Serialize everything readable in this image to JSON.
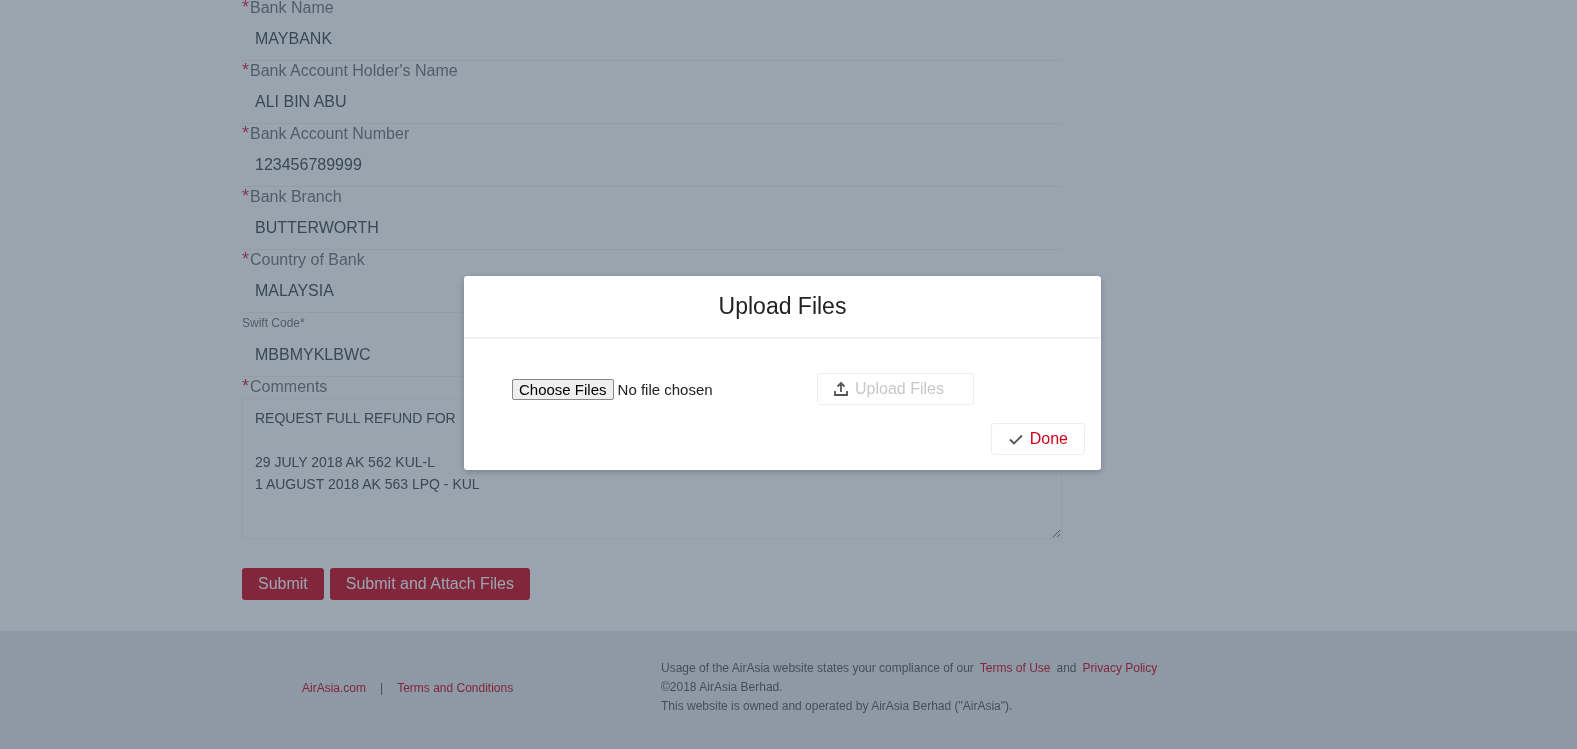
{
  "form": {
    "fields": [
      {
        "kind": "input",
        "marker": "*",
        "label": "Bank Name",
        "value": "MAYBANK"
      },
      {
        "kind": "input",
        "marker": "*",
        "label": "Bank Account Holder's Name",
        "value": "ALI BIN ABU"
      },
      {
        "kind": "input",
        "marker": "*",
        "label": "Bank Account Number",
        "value": "123456789999"
      },
      {
        "kind": "input",
        "marker": "*",
        "label": "Bank Branch",
        "value": "BUTTERWORTH"
      },
      {
        "kind": "input",
        "marker": "*",
        "label": "Country of Bank",
        "value": "MALAYSIA"
      },
      {
        "kind": "input",
        "label": "Swift Code*",
        "value": "MBBMYKLBWC"
      },
      {
        "kind": "textarea",
        "marker": "*",
        "label": "Comments",
        "value": "REQUEST FULL REFUND FOR\n\n29 JULY 2018 AK 562 KUL-L\n1 AUGUST 2018 AK 563 LPQ - KUL"
      }
    ],
    "buttons": [
      {
        "label": "Submit"
      },
      {
        "label": "Submit and Attach Files"
      }
    ]
  },
  "footer": {
    "links": [
      "AirAsia.com",
      "Terms and Conditions"
    ],
    "separator": "|",
    "notice": {
      "text": "Usage of the AirAsia website states your compliance of our",
      "link_1": "Terms of Use",
      "joiner": "and",
      "link_2": "Privacy Policy"
    },
    "copyright": "©2018 AirAsia Berhad.",
    "ownership": "This website is owned and operated by AirAsia Berhad (\"AirAsia\")."
  },
  "modal": {
    "title": "Upload Files",
    "choose_button": "Choose Files",
    "file_status": "No file chosen",
    "upload_button": {
      "label": "Upload Files",
      "disabled": true
    },
    "done_button": {
      "label": "Done"
    }
  }
}
